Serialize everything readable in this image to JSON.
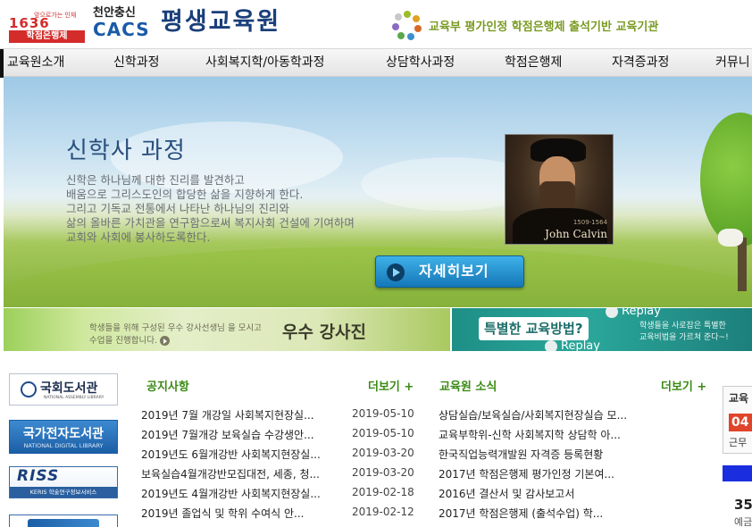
{
  "header": {
    "logo_tagline": "앞으로가는 인재",
    "logo_number": "1636",
    "logo_sub": "학점은행제",
    "cacs_ko": "천안충신",
    "cacs_en": "CACS",
    "title": "평생교육원",
    "certification": "교육부 평가인정 학점은행제 출석기반 교육기관"
  },
  "nav": {
    "items": [
      "교육원소개",
      "신학과정",
      "사회복지학/아동학과정",
      "상담학사과정",
      "학점은행제",
      "자격증과정",
      "커뮤니"
    ]
  },
  "hero": {
    "title": "신학사 과정",
    "description": [
      "신학은 하나님께 대한 진리를 발견하고",
      "배움으로 그리스도인의 합당한 삶을 지향하게 한다.",
      "그리고 기독교 전통에서 나타난 하나님의 진리와",
      "삶의 올바른 가치관을 연구함으로써 복지사회 건설에 기여하며",
      "교회와 사회에 봉사하도록한다."
    ],
    "portrait_dates": "1509-1564",
    "portrait_name": "John Calvin",
    "more_button": "자세히보기"
  },
  "banners": {
    "left_text_1": "학생들을 위해 구성된 우수 강사선생님 을 모시고",
    "left_text_2": "수업을 진행합니다.",
    "left_title": "우수 강사진",
    "right_title": "특별한 교육방법?",
    "replay": "Replay",
    "right_text_1": "학생들을 사로잡은 특별한",
    "right_text_2": "교육비법을 가르쳐 준다~!"
  },
  "libraries": {
    "nla_title": "국회도서관",
    "nla_sub": "NATIONAL ASSEMBLY LIBRARY",
    "ndl_title": "국가전자도서관",
    "ndl_sub": "NATIONAL DIGITAL LIBRARY",
    "riss_title": "RISS",
    "riss_sub": "KERIS 학술연구정보서비스"
  },
  "notice": {
    "title": "공지사항",
    "more": "더보기 +",
    "rows": [
      {
        "title": "2019년 7월 개강일 사회복지현장실...",
        "date": "2019-05-10"
      },
      {
        "title": "2019년 7월개강 보육실습 수강생안...",
        "date": "2019-05-10"
      },
      {
        "title": "2019년도 6월개강반 사회복지현장실...",
        "date": "2019-03-20"
      },
      {
        "title": "보육실습4월개강반모집대전, 세종, 청...",
        "date": "2019-03-20"
      },
      {
        "title": "2019년도 4월개강반 사회복지현장실...",
        "date": "2019-02-18"
      },
      {
        "title": "2019년 졸업식 및 학위 수여식 안...",
        "date": "2019-02-12"
      }
    ]
  },
  "news": {
    "title": "교육원 소식",
    "more": "더보기 +",
    "rows": [
      "상담실습/보육실습/사회복지현장실습 모...",
      "교육부학위-신학 사회복지학 상담학 아...",
      "한국직업능력개발원 자격증 등록현황",
      "2017년 학점은행제 평가인정 기본여...",
      "2016년 결산서 및 감사보고서",
      "2017년 학점은행제 (출석수업) 학..."
    ]
  },
  "right_edge": {
    "label": "교육",
    "digits": "04",
    "sub": "근무",
    "number": "35",
    "small": "예금"
  },
  "colors": {
    "accent_green": "#3b8a14",
    "title_blue": "#1a3f7a",
    "logo_red": "#d42b2b",
    "button_blue": "#1577b8"
  }
}
